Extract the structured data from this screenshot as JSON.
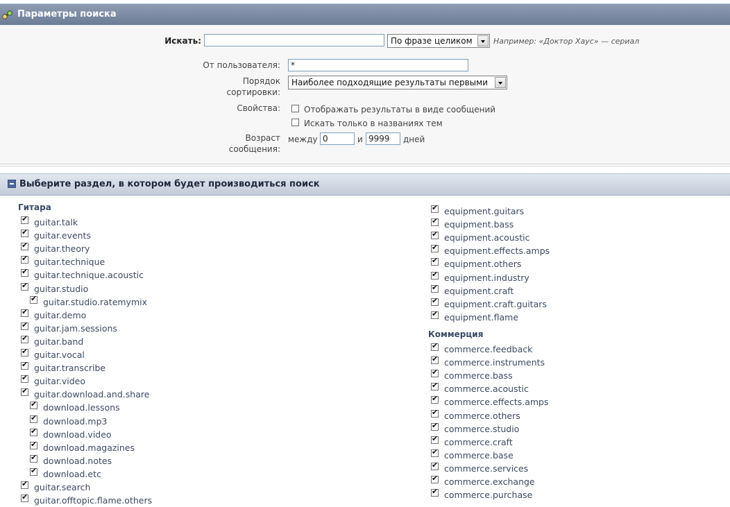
{
  "header": {
    "title": "Параметры поиска",
    "icon": "binoculars-icon"
  },
  "search": {
    "label": "Искать:",
    "query": "",
    "mode_value": "По фразе целиком",
    "hint": "Например: «Доктор Хаус» — сериал"
  },
  "user": {
    "label": "От пользователя:",
    "value": "*"
  },
  "sort": {
    "label_line1": "Порядок",
    "label_line2": "сортировки:",
    "value": "Наиболее подходящие результаты первыми"
  },
  "props": {
    "label": "Свойства:",
    "show_as_posts": {
      "label": "Отображать результаты в виде сообщений",
      "checked": false
    },
    "titles_only": {
      "label": "Искать только в названиях тем",
      "checked": false
    }
  },
  "age": {
    "label_line1": "Возраст",
    "label_line2": "сообщения:",
    "between": "между",
    "from": "0",
    "and": "и",
    "to": "9999",
    "unit": "дней"
  },
  "section": {
    "title": "Выберите раздел, в котором будет производиться поиск"
  },
  "left": {
    "group": "Гитара",
    "items": [
      {
        "label": "guitar.talk",
        "indent": 0
      },
      {
        "label": "guitar.events",
        "indent": 0
      },
      {
        "label": "guitar.theory",
        "indent": 0
      },
      {
        "label": "guitar.technique",
        "indent": 0
      },
      {
        "label": "guitar.technique.acoustic",
        "indent": 0
      },
      {
        "label": "guitar.studio",
        "indent": 0
      },
      {
        "label": "guitar.studio.ratemymix",
        "indent": 1
      },
      {
        "label": "guitar.demo",
        "indent": 0
      },
      {
        "label": "guitar.jam.sessions",
        "indent": 0
      },
      {
        "label": "guitar.band",
        "indent": 0
      },
      {
        "label": "guitar.vocal",
        "indent": 0
      },
      {
        "label": "guitar.transcribe",
        "indent": 0
      },
      {
        "label": "guitar.video",
        "indent": 0
      },
      {
        "label": "guitar.download.and.share",
        "indent": 0
      },
      {
        "label": "download.lessons",
        "indent": 1
      },
      {
        "label": "download.mp3",
        "indent": 1
      },
      {
        "label": "download.video",
        "indent": 1
      },
      {
        "label": "download.magazines",
        "indent": 1
      },
      {
        "label": "download.notes",
        "indent": 1
      },
      {
        "label": "download.etc",
        "indent": 1
      },
      {
        "label": "guitar.search",
        "indent": 0
      },
      {
        "label": "guitar.offtopic.flame.others",
        "indent": 0
      }
    ]
  },
  "right": {
    "equipment": [
      "equipment.guitars",
      "equipment.bass",
      "equipment.acoustic",
      "equipment.effects.amps",
      "equipment.others",
      "equipment.industry",
      "equipment.craft",
      "equipment.craft.guitars",
      "equipment.flame"
    ],
    "group": "Коммерция",
    "commerce": [
      "commerce.feedback",
      "commerce.instruments",
      "commerce.bass",
      "commerce.acoustic",
      "commerce.effects.amps",
      "commerce.others",
      "commerce.studio",
      "commerce.craft",
      "commerce.base",
      "commerce.services",
      "commerce.exchange",
      "commerce.purchase"
    ]
  }
}
